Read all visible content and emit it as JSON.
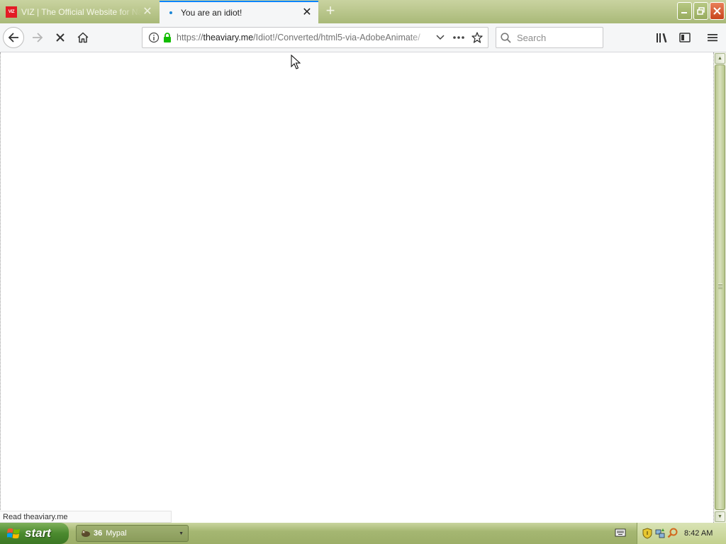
{
  "tabs": [
    {
      "title": "VIZ | The Official Website for Naruto",
      "favicon": "viz-logo",
      "active": false
    },
    {
      "title": "You are an idiot!",
      "favicon": "loading-dot",
      "active": true
    }
  ],
  "toolbar": {
    "url_prefix": "https://",
    "url_domain": "theaviary.me",
    "url_path": "/Idiot!/Converted/html5-via-AdobeAnimate/",
    "search_placeholder": "Search"
  },
  "status": {
    "text": "Read theaviary.me"
  },
  "taskbar": {
    "start_label": "start",
    "task_count": "36",
    "task_label": "Mypal",
    "clock": "8:42 AM"
  },
  "colors": {
    "tab_accent": "#0a84ff",
    "taskbar": "#a5b772",
    "start": "#4b8a2e",
    "close": "#c8441b"
  },
  "icons": [
    "back-arrow-icon",
    "forward-arrow-icon",
    "stop-icon",
    "home-icon",
    "info-icon",
    "lock-icon",
    "chevron-down-icon",
    "more-dots-icon",
    "star-icon",
    "search-icon",
    "library-icon",
    "sidebar-icon",
    "menu-icon"
  ]
}
